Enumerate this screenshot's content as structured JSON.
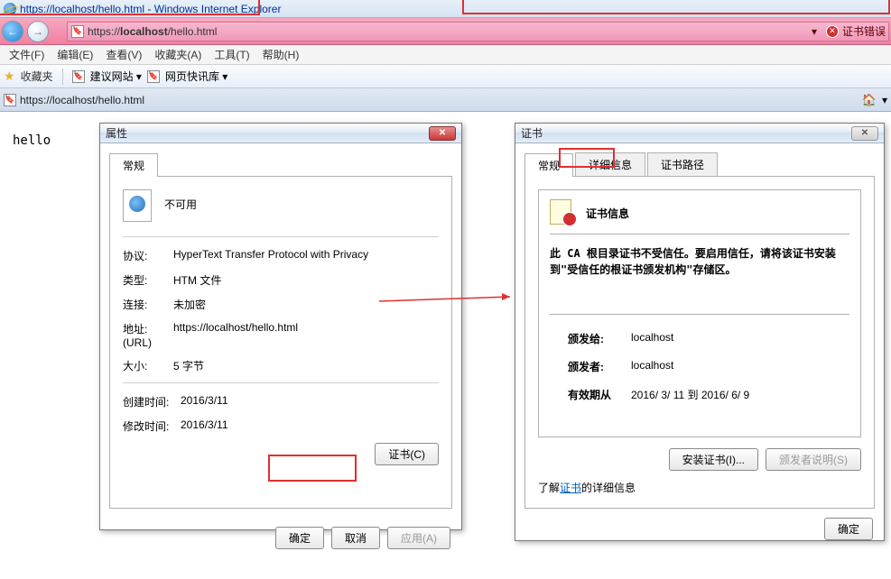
{
  "titlebar": {
    "text": "https://localhost/hello.html - Windows Internet Explorer"
  },
  "addr": {
    "url_prefix": "https://",
    "url_host": "localhost",
    "url_path": "/hello.html",
    "cert_error": "证书错误"
  },
  "menu": {
    "file": "文件(F)",
    "edit": "编辑(E)",
    "view": "查看(V)",
    "fav": "收藏夹(A)",
    "tools": "工具(T)",
    "help": "帮助(H)"
  },
  "favbar": {
    "label": "收藏夹",
    "suggest": "建议网站 ▾",
    "quick": "网页快讯库 ▾"
  },
  "tab": {
    "title": "https://localhost/hello.html"
  },
  "page": {
    "hello": "hello"
  },
  "props": {
    "title": "属性",
    "tab_general": "常规",
    "not_avail": "不可用",
    "k_proto": "协议:",
    "v_proto": "HyperText Transfer Protocol with Privacy",
    "k_type": "类型:",
    "v_type": "HTM 文件",
    "k_conn": "连接:",
    "v_conn": "未加密",
    "k_url": "地址:\n(URL)",
    "v_url": "https://localhost/hello.html",
    "k_size": "大小:",
    "v_size": "5 字节",
    "k_created": "创建时间:",
    "v_created": "2016/3/11",
    "k_modified": "修改时间:",
    "v_modified": "2016/3/11",
    "btn_cert": "证书(C)",
    "btn_ok": "确定",
    "btn_cancel": "取消",
    "btn_apply": "应用(A)"
  },
  "cert": {
    "title": "证书",
    "tab_general": "常规",
    "tab_detail": "详细信息",
    "tab_path": "证书路径",
    "info_title": "证书信息",
    "msg": "此 CA 根目录证书不受信任。要启用信任，请将该证书安装到\"受信任的根证书颁发机构\"存储区。",
    "k_issued_to": "颁发给:",
    "v_issued_to": "localhost",
    "k_issued_by": "颁发者:",
    "v_issued_by": "localhost",
    "k_valid": "有效期从",
    "v_valid": "2016/ 3/ 11  到   2016/ 6/ 9",
    "btn_install": "安装证书(I)...",
    "btn_issuer": "颁发者说明(S)",
    "learn_prefix": "了解",
    "learn_link": "证书",
    "learn_suffix": "的详细信息",
    "btn_ok": "确定"
  }
}
